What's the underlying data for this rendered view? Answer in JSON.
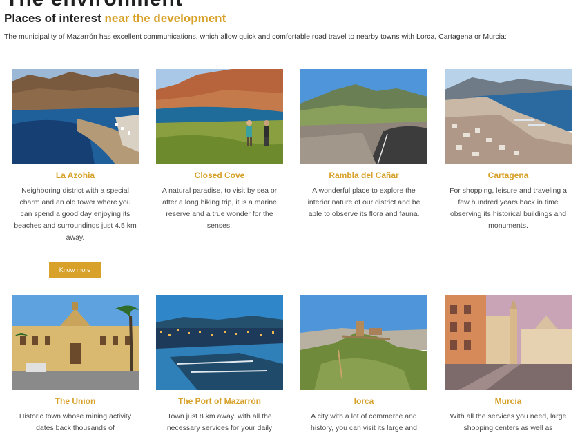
{
  "header": {
    "top_title": "The environment",
    "heading_part1": "Places of interest",
    "heading_part2": "near the development",
    "intro": "The municipality of Mazarrón has excellent communications, which allow quick and comfortable road travel to nearby towns with Lorca, Cartagena or Murcia:"
  },
  "cards": [
    {
      "title": "La Azohia",
      "text": "Neighboring district with a special charm and an old tower where you can spend a good day enjoying its beaches and surroundings just 4.5 km away."
    },
    {
      "title": "Closed Cove",
      "text": "A natural paradise, to visit by sea or after a long hiking trip, it is a marine reserve and a true wonder for the senses."
    },
    {
      "title": "Rambla del Cañar",
      "text": "A wonderful place to explore the interior nature of our district and be able to observe its flora and fauna."
    },
    {
      "title": "Cartagena",
      "text": "For shopping, leisure and traveling a few hundred years back in time observing its historical buildings and monuments."
    },
    {
      "title": "The Union",
      "text": "Historic town whose mining activity dates back thousands of"
    },
    {
      "title": "The Port of Mazarrón",
      "text": "Town just 8 km away. with all the necessary services for your daily"
    },
    {
      "title": "lorca",
      "text": "A city with a lot of commerce and history, you can visit its large and"
    },
    {
      "title": "Murcia",
      "text": "With all the services you need, large shopping centers as well as"
    }
  ],
  "know_more_label": "Know more",
  "colors": {
    "accent": "#d7a12a",
    "heading": "#1f1f1f",
    "body_text": "#4a4a4a"
  }
}
